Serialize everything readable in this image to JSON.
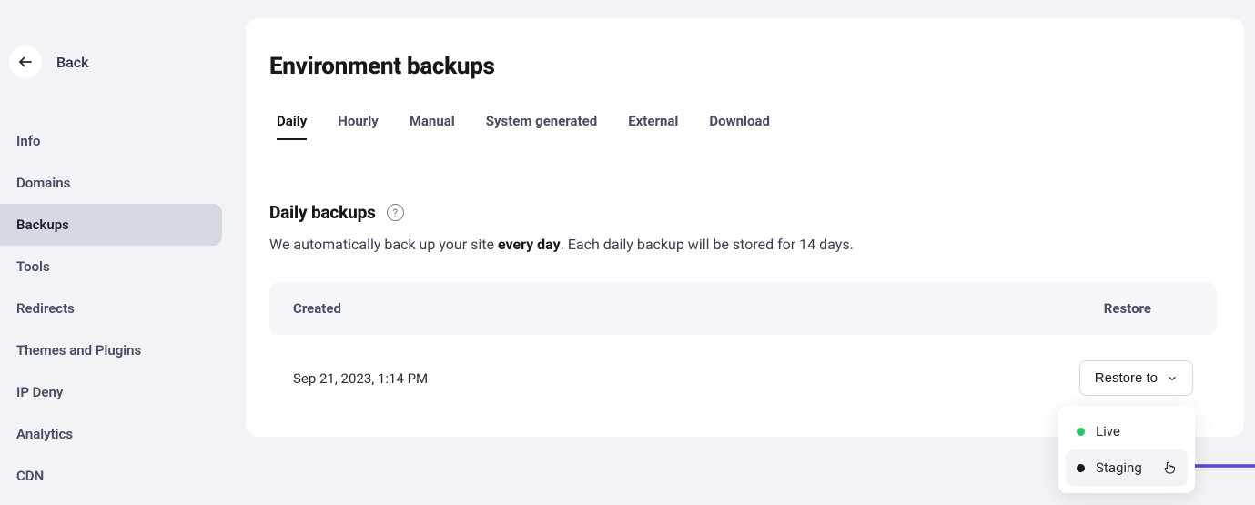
{
  "sidebar": {
    "back_label": "Back",
    "items": [
      {
        "label": "Info",
        "active": false
      },
      {
        "label": "Domains",
        "active": false
      },
      {
        "label": "Backups",
        "active": true
      },
      {
        "label": "Tools",
        "active": false
      },
      {
        "label": "Redirects",
        "active": false
      },
      {
        "label": "Themes and Plugins",
        "active": false
      },
      {
        "label": "IP Deny",
        "active": false
      },
      {
        "label": "Analytics",
        "active": false
      },
      {
        "label": "CDN",
        "active": false
      }
    ]
  },
  "main": {
    "title": "Environment backups",
    "tabs": [
      {
        "label": "Daily",
        "active": true
      },
      {
        "label": "Hourly",
        "active": false
      },
      {
        "label": "Manual",
        "active": false
      },
      {
        "label": "System generated",
        "active": false
      },
      {
        "label": "External",
        "active": false
      },
      {
        "label": "Download",
        "active": false
      }
    ],
    "section_title": "Daily backups",
    "help_glyph": "?",
    "desc_prefix": "We automatically back up your site ",
    "desc_bold": "every day",
    "desc_suffix": ". Each daily backup will be stored for 14 days.",
    "table": {
      "header_created": "Created",
      "header_restore": "Restore",
      "rows": [
        {
          "created": "Sep 21, 2023, 1:14 PM",
          "restore_label": "Restore to"
        }
      ]
    },
    "dropdown": {
      "items": [
        {
          "label": "Live",
          "dot_color": "green",
          "hovered": false
        },
        {
          "label": "Staging",
          "dot_color": "black",
          "hovered": true
        }
      ]
    }
  },
  "colors": {
    "annotation_arrow": "#5b3fd6"
  }
}
